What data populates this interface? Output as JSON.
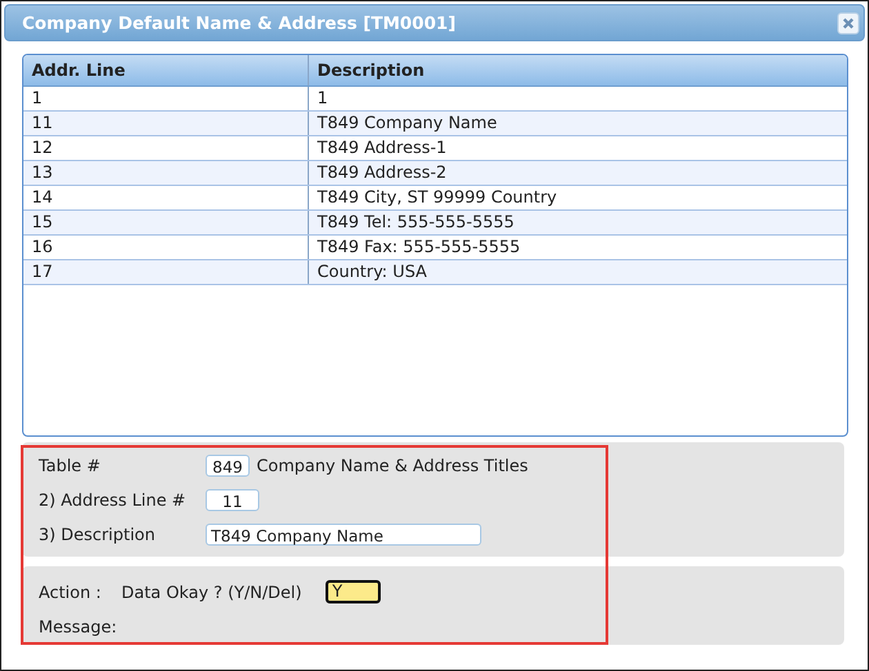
{
  "window": {
    "title": "Company Default Name & Address [TM0001]"
  },
  "table": {
    "columns": [
      "Addr. Line",
      "Description"
    ],
    "rows": [
      {
        "cells": [
          "1",
          "1"
        ]
      },
      {
        "cells": [
          "11",
          "T849 Company Name"
        ]
      },
      {
        "cells": [
          "12",
          "T849 Address-1"
        ]
      },
      {
        "cells": [
          "13",
          "T849 Address-2"
        ]
      },
      {
        "cells": [
          "14",
          "T849 City, ST 99999 Country"
        ]
      },
      {
        "cells": [
          "15",
          "T849 Tel: 555-555-5555"
        ]
      },
      {
        "cells": [
          "16",
          "T849 Fax: 555-555-5555"
        ]
      },
      {
        "cells": [
          "17",
          "Country: USA"
        ]
      }
    ]
  },
  "form": {
    "table_label": "Table #",
    "table_value": "849",
    "table_title": "Company Name & Address Titles",
    "fields": [
      {
        "label": "2) Address Line #",
        "value": "11",
        "kind": "short"
      },
      {
        "label": "3) Description",
        "value": "T849 Company Name",
        "kind": "long"
      }
    ]
  },
  "action": {
    "label": "Action :",
    "prompt": "Data Okay ? (Y/N/Del)",
    "value": "Y",
    "message_label": "Message:"
  }
}
